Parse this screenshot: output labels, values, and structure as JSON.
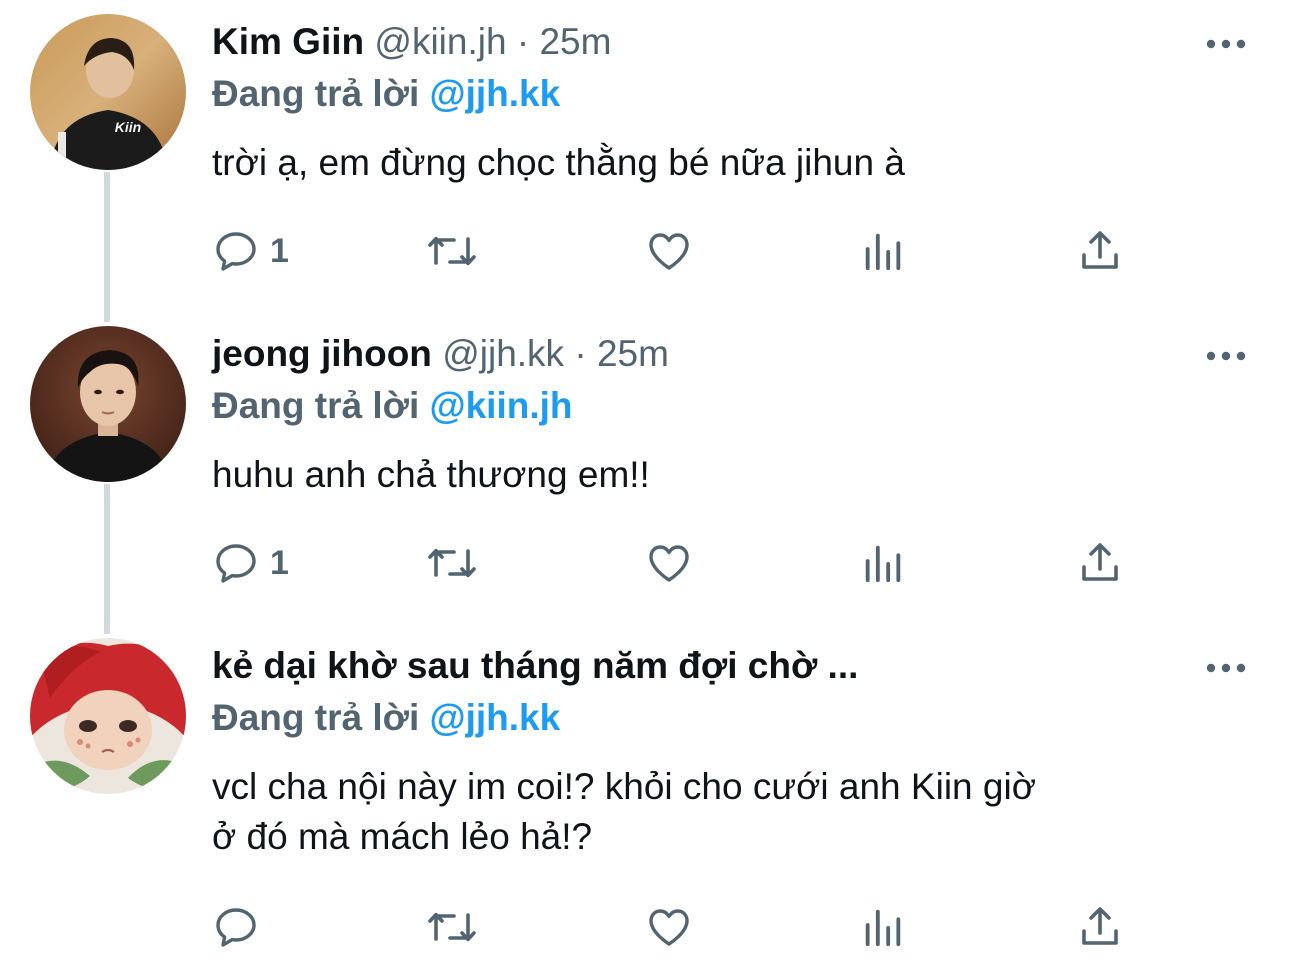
{
  "colors": {
    "text_primary": "#0f1419",
    "text_secondary": "#536471",
    "mention": "#1d9bf0",
    "thread_line": "#cfd9de"
  },
  "tweets": [
    {
      "display_name": "Kim Giin",
      "handle": "@kiin.jh",
      "separator": "·",
      "time": "25m",
      "replying_label": "Đang trả lời",
      "replying_to": "@jjh.kk",
      "text": "trời ạ, em đừng chọc thằng bé nữa jihun à",
      "reply_count": "1",
      "avatar_icon": "avatar-kiin",
      "avatar_jacket_text": "Kiin"
    },
    {
      "display_name": "jeong jihoon",
      "handle": "@jjh.kk",
      "separator": "·",
      "time": "25m",
      "replying_label": "Đang trả lời",
      "replying_to": "@kiin.jh",
      "text": "huhu anh chả thương em!!",
      "reply_count": "1",
      "avatar_icon": "avatar-jihoon"
    },
    {
      "display_name": "kẻ dại khờ sau tháng năm đợi chờ",
      "truncation": "...",
      "replying_label": "Đang trả lời",
      "replying_to": "@jjh.kk",
      "text_line1": "vcl cha nội này im coi!? khỏi cho cưới anh Kiin giờ",
      "text_line2": "ở đó mà mách lẻo hả!?",
      "reply_count": "",
      "avatar_icon": "avatar-doll"
    }
  ],
  "action_icons": [
    "reply-icon",
    "retweet-icon",
    "like-icon",
    "views-icon",
    "share-icon"
  ],
  "more_icon": "more-options-icon"
}
